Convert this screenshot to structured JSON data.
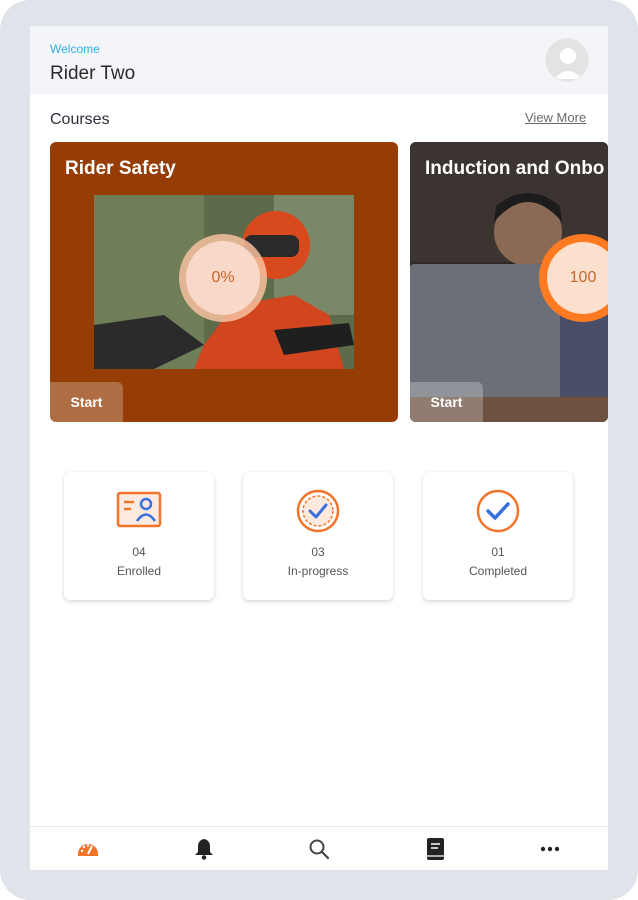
{
  "header": {
    "welcome": "Welcome",
    "username": "Rider Two"
  },
  "courses": {
    "title": "Courses",
    "view_more": "View More",
    "items": [
      {
        "title": "Rider Safety",
        "progress": "0%",
        "start_label": "Start"
      },
      {
        "title": "Induction and Onbo",
        "progress": "100",
        "start_label": "Start"
      }
    ]
  },
  "stats": [
    {
      "value": "04",
      "label": "Enrolled",
      "icon": "enrolled-card-icon"
    },
    {
      "value": "03",
      "label": "In-progress",
      "icon": "in-progress-check-icon"
    },
    {
      "value": "01",
      "label": "Completed",
      "icon": "completed-check-icon"
    }
  ],
  "nav": [
    "dashboard-icon",
    "bell-icon",
    "search-icon",
    "book-icon",
    "more-icon"
  ],
  "colors": {
    "accent": "#ff7a21",
    "welcome": "#2fb0e8",
    "card1_bg": "#953d05",
    "check_blue": "#3b6fe0"
  }
}
